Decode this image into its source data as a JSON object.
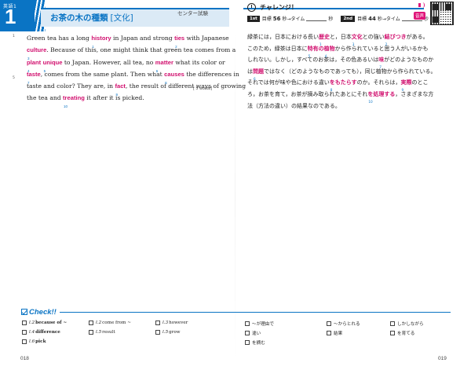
{
  "header": {
    "unit_label": "英語1",
    "unit_number": "1",
    "title": "お茶の木の種類",
    "title_tag": "[文化]",
    "exam_label": "センター試験",
    "challenge": "チャレンジ！",
    "timer": {
      "first_badge": "1st",
      "second_badge": "2nd",
      "goal_label": "目標",
      "first_goal": "56",
      "second_goal": "44",
      "unit_sec": "秒→タイム",
      "unit_sec_end": "秒"
    },
    "audio_label": "音声"
  },
  "english_rows": [
    [
      {
        "t": "Green tea has a long "
      },
      {
        "k": "history",
        "n": "1"
      },
      {
        "t": " in Japan and strong "
      },
      {
        "k": "ties",
        "n": "2"
      },
      {
        "t": " with Japanese"
      }
    ],
    [
      {
        "k": "culture",
        "n": "3"
      },
      {
        "t": ".  Because of this, one might think that green tea comes from a"
      }
    ],
    [
      {
        "k": "plant",
        "n": "4"
      },
      {
        "t": " "
      },
      {
        "k": "unique",
        "n": "5"
      },
      {
        "t": " to Japan.  However, all tea, no "
      },
      {
        "k": "matter",
        "n": "6"
      },
      {
        "t": " what its color or"
      }
    ],
    [
      {
        "k": "taste",
        "n": "7"
      },
      {
        "t": ", comes from the same plant.  Then what "
      },
      {
        "k": "causes",
        "n": "8"
      },
      {
        "t": " the differences in"
      }
    ],
    [
      {
        "t": "taste and color?  They are, in "
      },
      {
        "k": "fact",
        "n": "9"
      },
      {
        "t": ", the result of different ways of growing"
      }
    ],
    [
      {
        "t": "the tea and "
      },
      {
        "k": "treating",
        "n": "10"
      },
      {
        "t": " it after it is picked."
      }
    ]
  ],
  "line_numbers": [
    "1",
    "5"
  ],
  "word_count": "[ 5 words]",
  "japanese_rows": [
    [
      {
        "t": "緑茶には，日本における長い"
      },
      {
        "k": "歴史",
        "n": "1"
      },
      {
        "t": "と，日本"
      },
      {
        "k": "文化",
        "n": "3"
      },
      {
        "t": "との強い"
      },
      {
        "k": "結びつき",
        "n": "2"
      },
      {
        "t": "がある。"
      }
    ],
    [
      {
        "t": "このため，緑茶は日本に"
      },
      {
        "k": "特有の",
        "n": "5"
      },
      {
        "k": "植物",
        "n": "4"
      },
      {
        "t": "から作られていると思う人がいるかも"
      }
    ],
    [
      {
        "t": "しれない。しかし，すべてのお茶は，その色あるいは"
      },
      {
        "k": "味",
        "n": "7"
      },
      {
        "t": "がどのようなものか"
      }
    ],
    [
      {
        "t": "は"
      },
      {
        "k": "問題",
        "n": "6"
      },
      {
        "t": "ではなく（どのようなものであっても），同じ植物から作られている。"
      }
    ],
    [
      {
        "t": "それでは何が味や色における違い"
      },
      {
        "k": "をもたらす",
        "n": "8"
      },
      {
        "t": "のか。それらは，"
      },
      {
        "k": "実際",
        "n": "9"
      },
      {
        "t": "のとこ"
      }
    ],
    [
      {
        "t": "ろ，お茶を育て，お茶が摘み取られたあとにそれ"
      },
      {
        "k": "を処理する",
        "n": "10"
      },
      {
        "t": "，さまざまな方"
      }
    ],
    [
      {
        "t": "法（方法の違い）の結果なのである。"
      }
    ]
  ],
  "check": {
    "title": "Check!!",
    "items": [
      {
        "ref": "l.2",
        "term": "because of ~",
        "bold": true
      },
      {
        "ref": "l.2",
        "term": "come from ~",
        "bold": false
      },
      {
        "ref": "l.3",
        "term": "however",
        "bold": false
      },
      {
        "ref": "",
        "term": "～が理由で",
        "bold": false
      },
      {
        "ref": "",
        "term": "～からとれる",
        "bold": false
      },
      {
        "ref": "",
        "term": "しかしながら",
        "bold": false
      },
      {
        "ref": "l.4",
        "term": "difference",
        "bold": true
      },
      {
        "ref": "l.5",
        "term": "result",
        "bold": false
      },
      {
        "ref": "l.5",
        "term": "grow",
        "bold": false
      },
      {
        "ref": "",
        "term": "違い",
        "bold": false
      },
      {
        "ref": "",
        "term": "結果",
        "bold": false
      },
      {
        "ref": "",
        "term": "を育てる",
        "bold": false
      },
      {
        "ref": "l.6",
        "term": "pick",
        "bold": true
      },
      {
        "ref": "",
        "term": "を摘む",
        "bold": false
      }
    ]
  },
  "page_numbers": {
    "left": "018",
    "right": "019"
  }
}
